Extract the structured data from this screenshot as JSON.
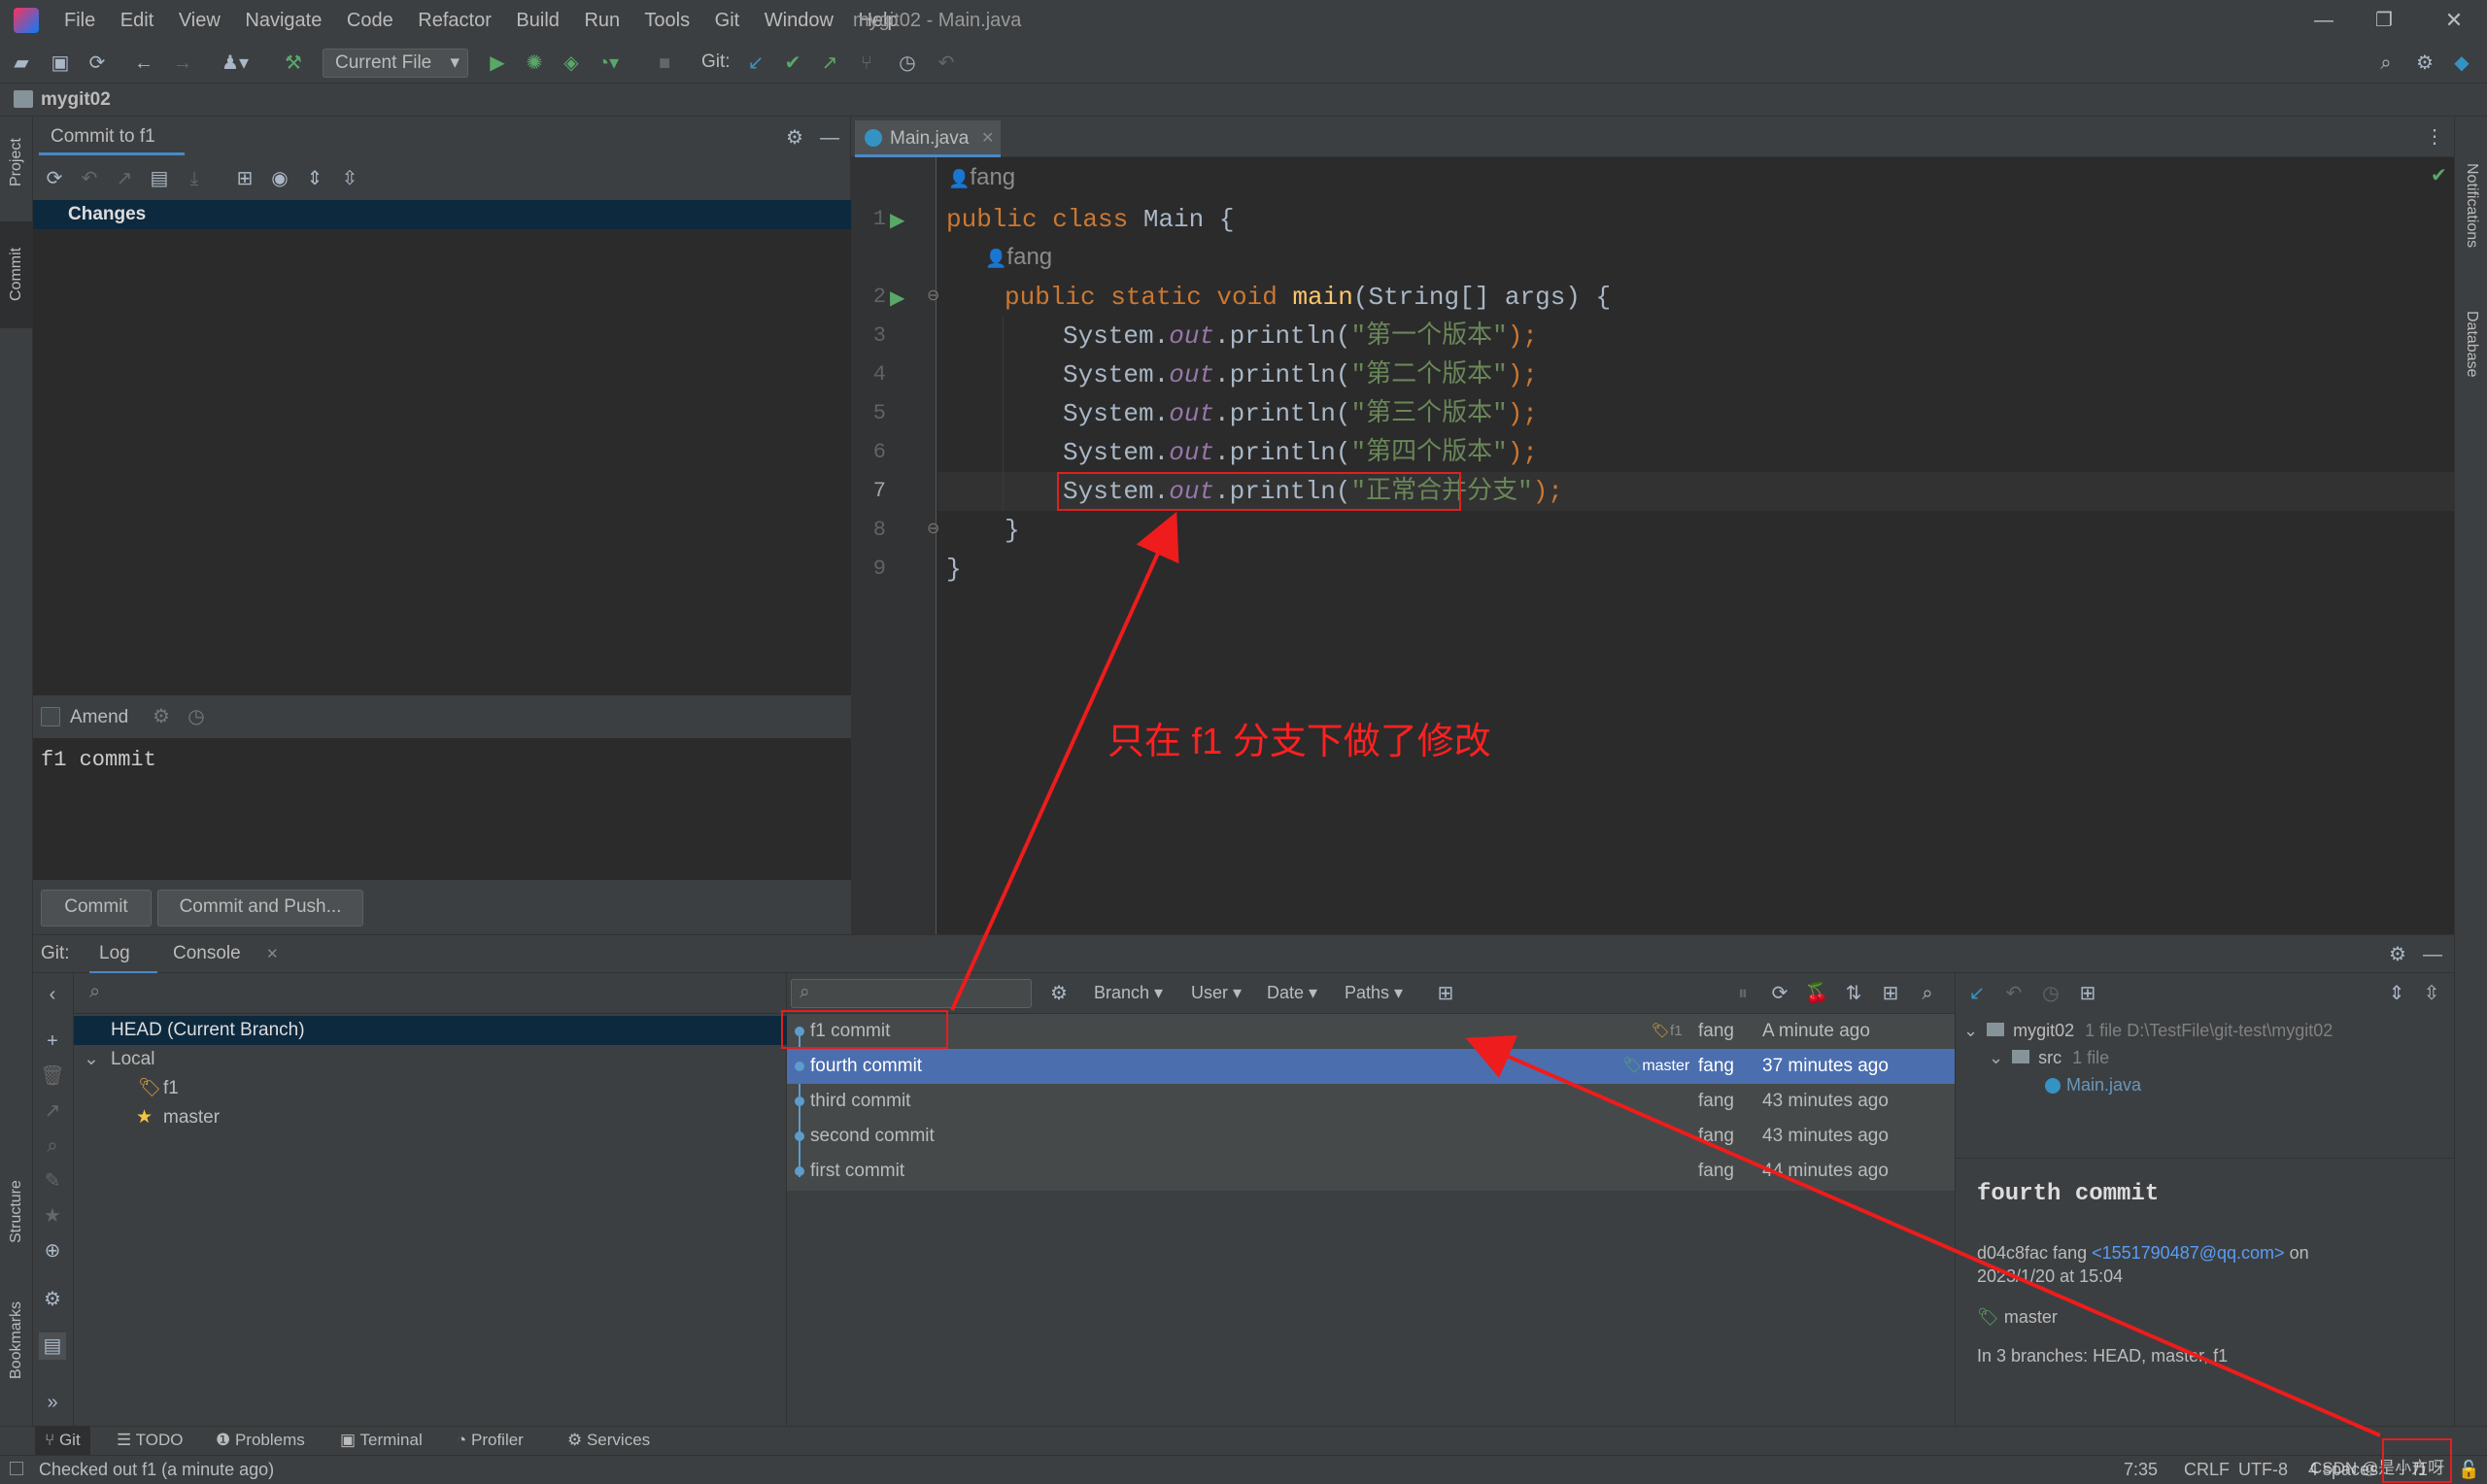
{
  "window": {
    "title": "mygit02 - Main.java"
  },
  "menu": [
    "File",
    "Edit",
    "View",
    "Navigate",
    "Code",
    "Refactor",
    "Build",
    "Run",
    "Tools",
    "Git",
    "Window",
    "Help"
  ],
  "toolbar": {
    "run_config": "Current File",
    "git_label": "Git:"
  },
  "project": {
    "name": "mygit02"
  },
  "left_strip": {
    "project": "Project",
    "commit": "Commit",
    "structure": "Structure",
    "bookmarks": "Bookmarks"
  },
  "right_strip": {
    "notifications": "Notifications",
    "database": "Database"
  },
  "commit_panel": {
    "tab": "Commit to f1",
    "changes": "Changes",
    "amend": "Amend",
    "message": "f1 commit",
    "commit_btn": "Commit",
    "commit_push_btn": "Commit and Push..."
  },
  "editor": {
    "tab": "Main.java",
    "author_hint": "fang",
    "lines": [
      "1",
      "2",
      "3",
      "4",
      "5",
      "6",
      "7",
      "8",
      "9"
    ],
    "code": {
      "l1_kw": "public class ",
      "l1_name": "Main",
      "l1_rest": " {",
      "l2_kw": "public static void ",
      "l2_fn": "main",
      "l2_rest": "(String[] args) {",
      "sys": "System.",
      "out": "out",
      "println": ".println(",
      "s3": "\"第一个版本\"",
      "s4": "\"第二个版本\"",
      "s5": "\"第三个版本\"",
      "s6": "\"第四个版本\"",
      "s7": "\"正常合并分支\"",
      "end": ");",
      "close_inner": "}",
      "close_outer": "}"
    },
    "annotation": "只在 f1 分支下做了修改"
  },
  "git_panel": {
    "label": "Git:",
    "tabs": [
      "Log",
      "Console"
    ],
    "branches": {
      "head": "HEAD (Current Branch)",
      "local": "Local",
      "f1": "f1",
      "master": "master"
    },
    "filters": [
      "Branch",
      "User",
      "Date",
      "Paths"
    ],
    "commits": [
      {
        "msg": "f1 commit",
        "tag": "f1",
        "author": "fang",
        "date": "A minute ago"
      },
      {
        "msg": "fourth commit",
        "tag": "master",
        "author": "fang",
        "date": "37 minutes ago"
      },
      {
        "msg": "third commit",
        "tag": "",
        "author": "fang",
        "date": "43 minutes ago"
      },
      {
        "msg": "second commit",
        "tag": "",
        "author": "fang",
        "date": "43 minutes ago"
      },
      {
        "msg": "first commit",
        "tag": "",
        "author": "fang",
        "date": "44 minutes ago"
      }
    ],
    "details": {
      "repo": "mygit02",
      "repo_meta": "1 file  D:\\TestFile\\git-test\\mygit02",
      "src": "src",
      "src_meta": "1 file",
      "file": "Main.java",
      "title": "fourth commit",
      "hash_author": "d04c8fac fang",
      "email": "<1551790487@qq.com>",
      "on": "on",
      "date": "2023/1/20 at 15:04",
      "branch_tag": "master",
      "branches": "In 3 branches: HEAD, master, f1"
    }
  },
  "bottom_tabs": [
    "Git",
    "TODO",
    "Problems",
    "Terminal",
    "Profiler",
    "Services"
  ],
  "status": {
    "message": "Checked out f1 (a minute ago)",
    "pos": "7:35",
    "eol": "CRLF",
    "encoding": "UTF-8",
    "indent": "4 spaces",
    "branch": "f1",
    "watermark": "CSDN @是小方呀"
  }
}
